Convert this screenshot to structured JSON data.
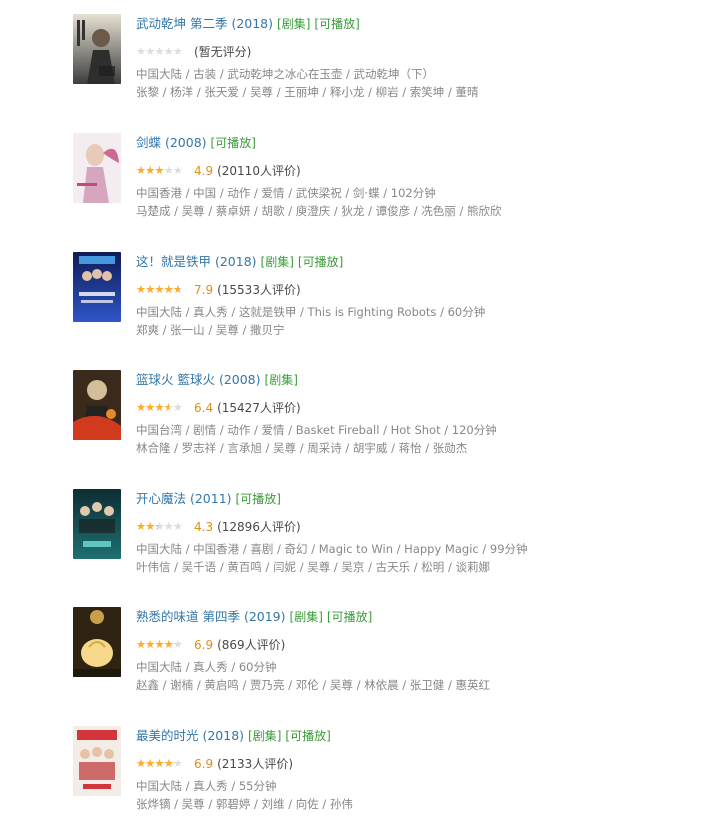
{
  "items": [
    {
      "title": "武动乾坤 第二季 (2018)",
      "tags": [
        "[剧集]",
        "[可播放]"
      ],
      "stars_fraction": 0,
      "score": "",
      "rating_text": "(暂无评分)",
      "meta1": "中国大陆 / 古装 / 武动乾坤之冰心在玉壶 / 武动乾坤（下）",
      "meta2": "张黎 / 杨洋 / 张天爱 / 吴尊 / 王丽坤 / 释小龙 / 柳岩 / 索笑坤 / 董晴",
      "poster_colors": [
        "#5a5a5a",
        "#c9c4b6"
      ]
    },
    {
      "title": "剑蝶 (2008)",
      "tags": [
        "[可播放]"
      ],
      "stars_fraction": 0.5,
      "score": "4.9",
      "rating_text": "(20110人评价)",
      "meta1": "中国香港 / 中国 / 动作 / 爱情 / 武侠梁祝 / 剑·蝶 / 102分钟",
      "meta2": "马楚成 / 吴尊 / 蔡卓妍 / 胡歌 / 庾澄庆 / 狄龙 / 谭俊彦 / 冼色丽 / 熊欣欣",
      "poster_colors": [
        "#e9dde6",
        "#c44a7a"
      ]
    },
    {
      "title": "这！就是铁甲 (2018)",
      "tags": [
        "[剧集]",
        "[可播放]"
      ],
      "stars_fraction": 0.8,
      "score": "7.9",
      "rating_text": "(15533人评价)",
      "meta1": "中国大陆 / 真人秀 / 这就是铁甲 / This is Fighting Robots / 60分钟",
      "meta2": "郑爽 / 张一山 / 吴尊 / 撒贝宁",
      "poster_colors": [
        "#1b2a7a",
        "#3b5fd0"
      ]
    },
    {
      "title": "篮球火 籃球火 (2008)",
      "tags": [
        "[剧集]"
      ],
      "stars_fraction": 0.6,
      "score": "6.4",
      "rating_text": "(15427人评价)",
      "meta1": "中国台湾 / 剧情 / 动作 / 爱情 / Basket Fireball / Hot Shot / 120分钟",
      "meta2": "林合隆 / 罗志祥 / 言承旭 / 吴尊 / 周采诗 / 胡宇威 / 蒋怡 / 张勋杰",
      "poster_colors": [
        "#2a1d14",
        "#d23a1e"
      ]
    },
    {
      "title": "开心魔法 (2011)",
      "tags": [
        "[可播放]"
      ],
      "stars_fraction": 0.4,
      "score": "4.3",
      "rating_text": "(12896人评价)",
      "meta1": "中国大陆 / 中国香港 / 喜剧 / 奇幻 / Magic to Win / Happy Magic / 99分钟",
      "meta2": "叶伟信 / 吴千语 / 黄百鸣 / 闫妮 / 吴尊 / 吴京 / 古天乐 / 松明 / 谈莉娜",
      "poster_colors": [
        "#123a40",
        "#3fb0a8"
      ]
    },
    {
      "title": "熟悉的味道 第四季 (2019)",
      "tags": [
        "[剧集]",
        "[可播放]"
      ],
      "stars_fraction": 0.7,
      "score": "6.9",
      "rating_text": "(869人评价)",
      "meta1": "中国大陆 / 真人秀 / 60分钟",
      "meta2": "赵鑫 / 谢楠 / 黄启鸣 / 贾乃亮 / 邓伦 / 吴尊 / 林依晨 / 张卫健 / 惠英红",
      "poster_colors": [
        "#3a2a10",
        "#f2c24a"
      ]
    },
    {
      "title": "最美的时光 (2018)",
      "tags": [
        "[剧集]",
        "[可播放]"
      ],
      "stars_fraction": 0.7,
      "score": "6.9",
      "rating_text": "(2133人评价)",
      "meta1": "中国大陆 / 真人秀 / 55分钟",
      "meta2": "张烨镝 / 吴尊 / 郭碧婷 / 刘维 / 向佐 / 孙伟",
      "poster_colors": [
        "#f1e6e0",
        "#d2363b"
      ]
    }
  ]
}
